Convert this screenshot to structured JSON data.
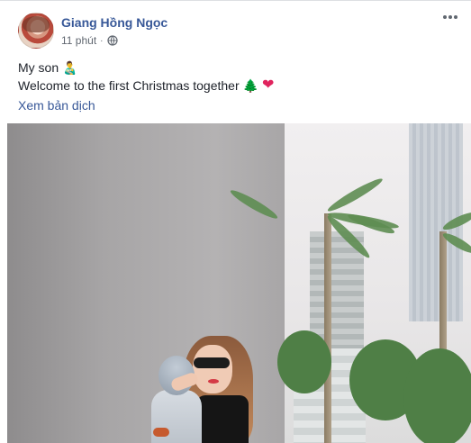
{
  "post": {
    "author": "Giang Hồng Ngọc",
    "time": "11 phút",
    "separator": "·",
    "privacy_icon": "globe-icon",
    "more_icon": "more-options-icon",
    "text_line1": "My son",
    "emoji_line1": "👨‍🍼",
    "text_line2": "Welcome to the first Christmas together",
    "emoji_tree": "🌲",
    "emoji_heart": "❤",
    "see_translation": "Xem bản dịch"
  },
  "colors": {
    "link": "#385898",
    "meta": "#606770",
    "text": "#1d2129"
  }
}
